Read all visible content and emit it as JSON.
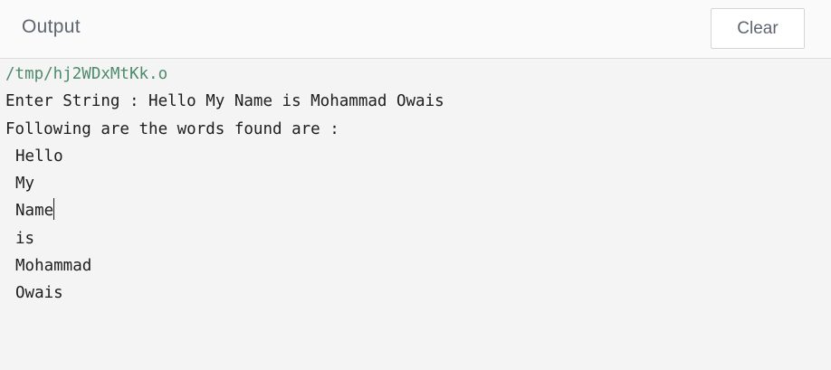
{
  "header": {
    "title": "Output",
    "clear_label": "Clear"
  },
  "console": {
    "path": "/tmp/hj2WDxMtKk.o",
    "prompt_line": "Enter String : Hello My Name is Mohammad Owais",
    "result_heading": "Following are the words found are :",
    "words": [
      "Hello",
      "My",
      "Name",
      "is",
      "Mohammad",
      "Owais"
    ],
    "caret_after_word": "Name"
  },
  "colors": {
    "background": "#f4f4f4",
    "header_background": "#fafafa",
    "path_text": "#4e8a6d",
    "console_text": "#1d1d1d",
    "header_text": "#5f6570"
  }
}
